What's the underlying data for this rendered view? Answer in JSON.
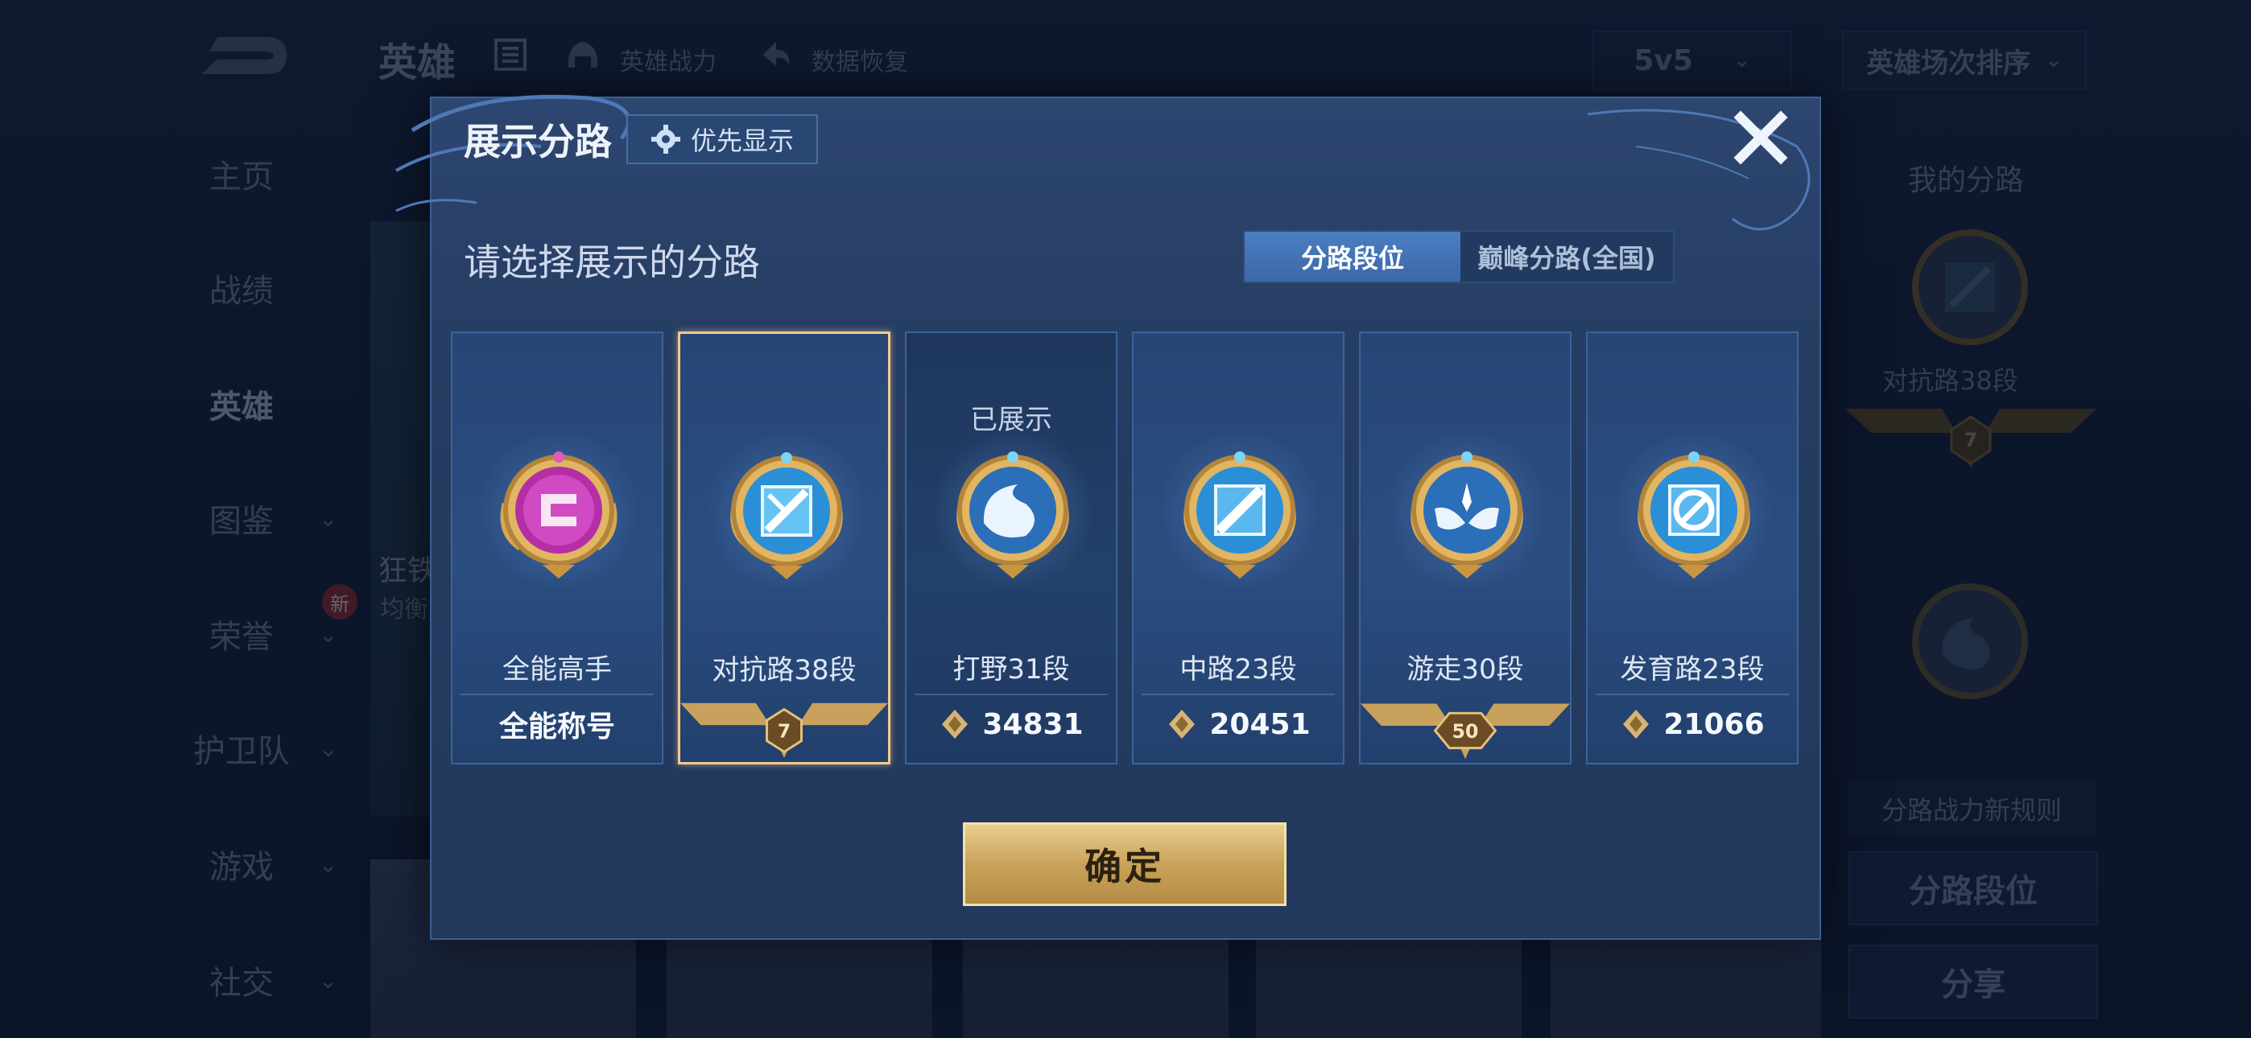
{
  "background": {
    "nav": {
      "title": "英雄",
      "power": "英雄战力",
      "restore": "数据恢复",
      "mode": "5v5",
      "sort": "英雄场次排序"
    },
    "sidebar": [
      {
        "label": "主页"
      },
      {
        "label": "战绩"
      },
      {
        "label": "英雄"
      },
      {
        "label": "图鉴"
      },
      {
        "label": "荣誉"
      },
      {
        "label": "护卫队"
      },
      {
        "label": "游戏"
      },
      {
        "label": "社交"
      }
    ],
    "new_badge": "新",
    "hero_card": {
      "name": "狂铁",
      "sub": "均衡"
    },
    "right_panel": {
      "title": "我的分路",
      "badge_label": "对抗路38段",
      "badge_star": "7",
      "rule": "分路战力新规则",
      "btn_rank": "分路段位",
      "btn_share": "分享"
    }
  },
  "modal": {
    "title": "展示分路",
    "priority_label": "优先显示",
    "prompt": "请选择展示的分路",
    "tabs": [
      {
        "label": "分路段位",
        "active": true
      },
      {
        "label": "巅峰分路(全国)",
        "active": false
      }
    ],
    "cards": [
      {
        "name": "全能高手",
        "bottom_text": "全能称号",
        "bottom_kind": "text",
        "selected": false,
        "status": ""
      },
      {
        "name": "对抗路38段",
        "bottom_text": "7",
        "bottom_kind": "ribbon",
        "selected": true,
        "status": ""
      },
      {
        "name": "打野31段",
        "bottom_text": "34831",
        "bottom_kind": "score",
        "selected": false,
        "status": "已展示"
      },
      {
        "name": "中路23段",
        "bottom_text": "20451",
        "bottom_kind": "score",
        "selected": false,
        "status": ""
      },
      {
        "name": "游走30段",
        "bottom_text": "50",
        "bottom_kind": "ribbon",
        "selected": false,
        "status": ""
      },
      {
        "name": "发育路23段",
        "bottom_text": "21066",
        "bottom_kind": "score",
        "selected": false,
        "status": ""
      }
    ],
    "confirm": "确定"
  },
  "colors": {
    "accent_blue": "#4b7ec2",
    "gold": "#d9b56b",
    "selected_border": "#f2c98e",
    "panel": "#263d63"
  }
}
